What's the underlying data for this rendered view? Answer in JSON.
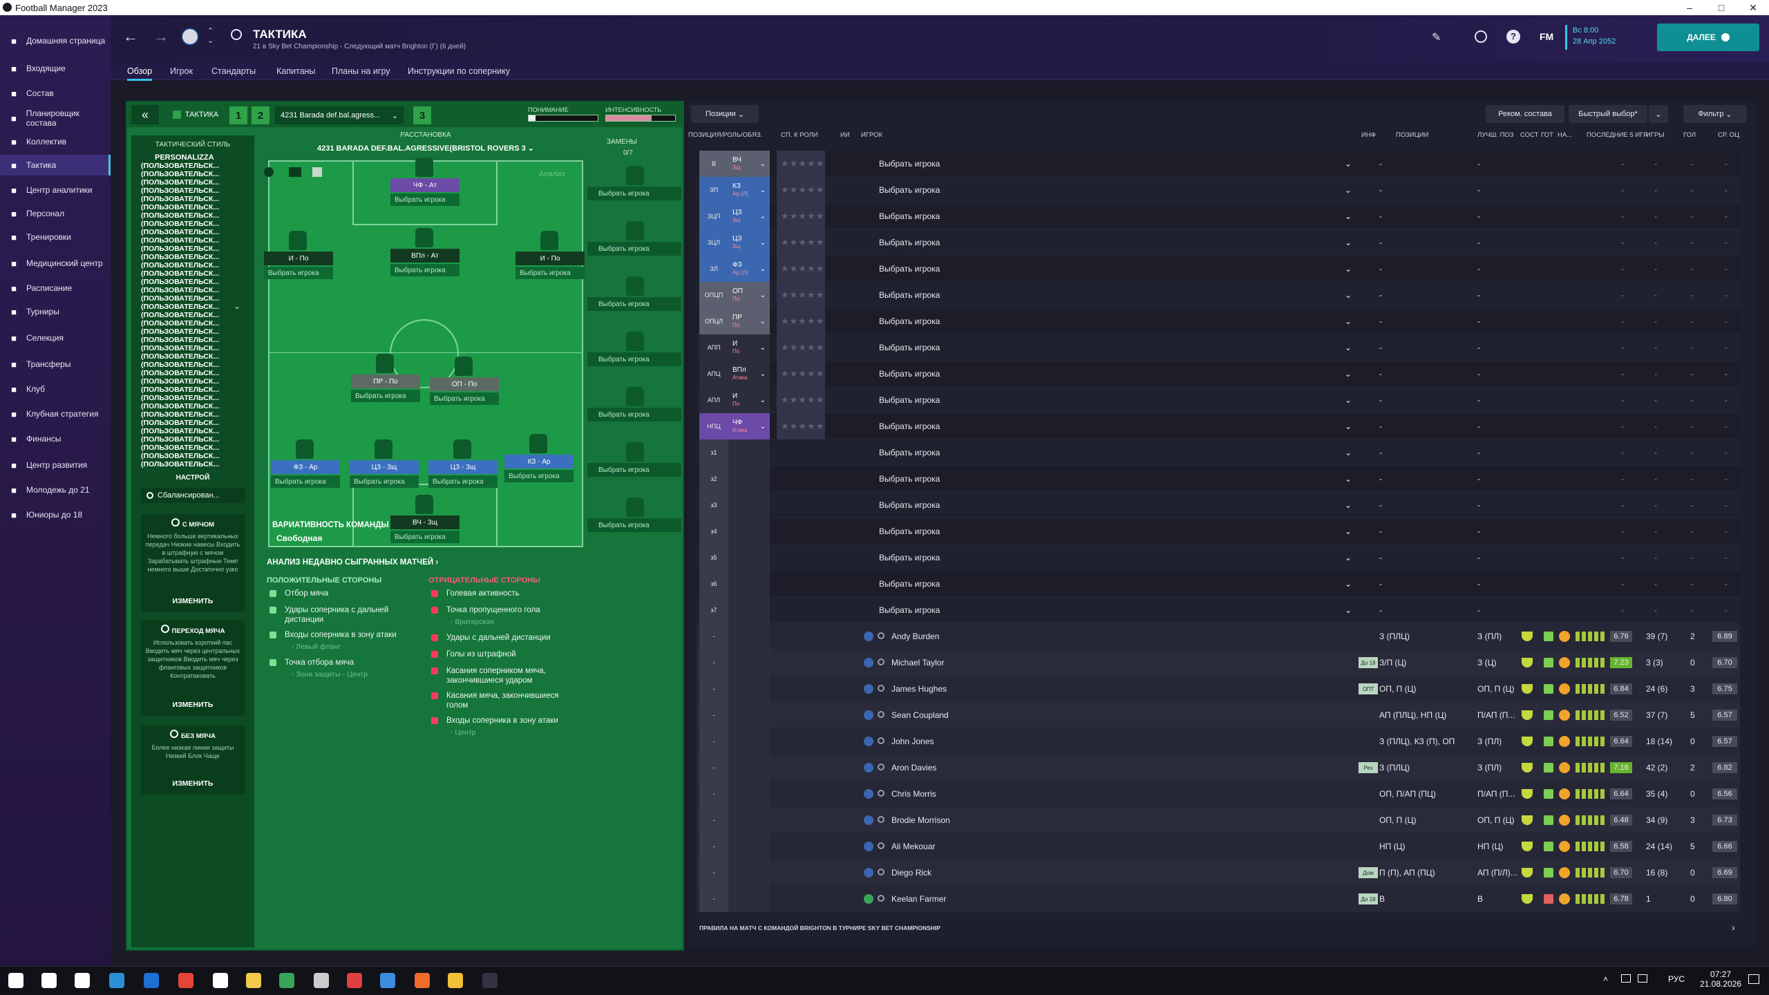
{
  "window": {
    "title": "Football Manager 2023"
  },
  "sidebar": {
    "items": [
      {
        "label": "Домашняя страница",
        "icon": "home-icon"
      },
      {
        "label": "Входящие",
        "icon": "inbox-icon"
      },
      {
        "label": "Состав",
        "icon": "squad-icon"
      },
      {
        "label": "Планировщик состава",
        "icon": "planner-icon"
      },
      {
        "label": "Коллектив",
        "icon": "dynamics-icon"
      },
      {
        "label": "Тактика",
        "icon": "tactics-icon"
      },
      {
        "label": "Центр аналитики",
        "icon": "analytics-icon"
      },
      {
        "label": "Персонал",
        "icon": "staff-icon"
      },
      {
        "label": "Тренировки",
        "icon": "training-icon"
      },
      {
        "label": "Медицинский центр",
        "icon": "medical-icon"
      },
      {
        "label": "Расписание",
        "icon": "schedule-icon"
      },
      {
        "label": "Турниры",
        "icon": "trophy-icon"
      },
      {
        "label": "Селекция",
        "icon": "scouting-icon"
      },
      {
        "label": "Трансферы",
        "icon": "transfers-icon"
      },
      {
        "label": "Клуб",
        "icon": "club-icon"
      },
      {
        "label": "Клубная стратегия",
        "icon": "strategy-icon"
      },
      {
        "label": "Финансы",
        "icon": "finance-icon"
      },
      {
        "label": "Центр развития",
        "icon": "development-icon"
      },
      {
        "label": "Молодежь до 21",
        "icon": "u21-icon"
      },
      {
        "label": "Юниоры до 18",
        "icon": "u18-icon"
      }
    ]
  },
  "header": {
    "title": "ТАКТИКА",
    "subtitle": "21 в Sky Bet Championship - Следующий матч Brighton (Г) (6 дней)",
    "date_time": "Вс 8:00",
    "date": "28 Апр 2052",
    "next_label": "ДАЛЕЕ",
    "fm_label": "FM"
  },
  "tabs": [
    "Обзор",
    "Игрок",
    "Стандарты",
    "Капитаны",
    "Планы на игру",
    "Инструкции по сопернику"
  ],
  "tactic": {
    "tag": "ТАКТИКА",
    "slots": [
      "1",
      "2",
      "3"
    ],
    "selected": "4231 Barada def.bal.agress...",
    "understanding_label": "ПОНИМАНИЕ",
    "intensity_label": "ИНТЕНСИВНОСТЬ",
    "style_title": "ТАКТИЧЕСКИЙ СТИЛЬ",
    "style_name": "PERSONALIZZA",
    "style_lines_text": "(ПОЛЬЗОВАТЕЛЬСК...",
    "style_lines_count": 37,
    "mentality_title": "НАСТРОЙ",
    "mentality": "Сбалансирован...",
    "in_possession": {
      "title": "С МЯЧОМ",
      "text": "Немного больше вертикальных передач Низкие навесы Входить в штрафную с мячом Зарабатывать штрафные Темп немного выше Достаточно узко",
      "action": "ИЗМЕНИТЬ"
    },
    "transition": {
      "title": "ПЕРЕХОД МЯЧА",
      "text": "Использовать короткий пас Вводить мяч через центральных защитников Вводить мяч через фланговых защитников Контратаковать",
      "action": "ИЗМЕНИТЬ"
    },
    "out_possession": {
      "title": "БЕЗ МЯЧА",
      "text": "Более низкая линия защиты Низкий Блок Чаще",
      "action": "ИЗМЕНИТЬ"
    },
    "formation_title": "РАССТАНОВКА",
    "formation_name": "4231 BARADA DEF.BAL.AGRESSIVE(BRISTOL ROVERS 3",
    "subs_label": "ЗАМЕНЫ",
    "subs_count": "0/7",
    "analysis_btn": "Анализ",
    "pick_label": "Выбрать игрока",
    "fluidity_title": "ВАРИАТИВНОСТЬ КОМАНДЫ",
    "fluidity_value": "Свободная"
  },
  "pitch_positions": [
    {
      "label": "ЧФ - Ат"
    },
    {
      "label": "И - По"
    },
    {
      "label": "ВПл - Ат"
    },
    {
      "label": "И - По"
    },
    {
      "label": "ПР - По"
    },
    {
      "label": "ОП - По"
    },
    {
      "label": "ФЗ - Ар"
    },
    {
      "label": "ЦЗ - Зщ"
    },
    {
      "label": "ЦЗ - Зщ"
    },
    {
      "label": "КЗ - Ар"
    },
    {
      "label": "ВЧ - Зщ"
    }
  ],
  "analysis": {
    "title": "АНАЛИЗ НЕДАВНО СЫГРАННЫХ МАТЧЕЙ",
    "positive_title": "ПОЛОЖИТЕЛЬНЫЕ СТОРОНЫ",
    "negative_title": "ОТРИЦАТЕЛЬНЫЕ СТОРОНЫ",
    "positive": [
      {
        "t": "Отбор мяча",
        "s": ""
      },
      {
        "t": "Удары соперника с дальней дистанции",
        "s": ""
      },
      {
        "t": "Входы соперника в зону атаки",
        "s": "- Левый фланг"
      },
      {
        "t": "Точка отбора мяча",
        "s": "- Зона защиты - Центр"
      }
    ],
    "negative": [
      {
        "t": "Голевая активность",
        "s": ""
      },
      {
        "t": "Точка пропущенного гола",
        "s": "- Вратарская"
      },
      {
        "t": "Удары с дальней дистанции",
        "s": ""
      },
      {
        "t": "Голы из штрафной",
        "s": ""
      },
      {
        "t": "Касания соперником мяча, закончившиеся ударом",
        "s": ""
      },
      {
        "t": "Касания мяча, закончившиеся голом",
        "s": ""
      },
      {
        "t": "Входы соперника в зону атаки",
        "s": "- Центр"
      }
    ]
  },
  "right": {
    "positions_btn": "Позиции",
    "recommend_btn": "Реком. состава",
    "quick_btn": "Быстрый выбор*",
    "filter_btn": "Фильтр",
    "columns": [
      "ПОЗИЦИЯ/РОЛЬ/ОБЯЗ.",
      "СП. К РОЛИ",
      "ИИ",
      "ИГРОК",
      "ИНФ",
      "ПОЗИЦИИ",
      "ЛУЧШ. ПОЗ",
      "СОСТ",
      "ГОТ",
      "НА...",
      "ПОСЛЕДНИЕ 5 ИГР",
      "ИГРЫ",
      "ГОЛ",
      "СР. ОЦ"
    ],
    "slots": [
      {
        "code": "В",
        "role": "ВЧ",
        "duty": "Зщ",
        "tone": "gray"
      },
      {
        "code": "ЗП",
        "role": "КЗ",
        "duty": "Ар (Л)",
        "tone": "blue"
      },
      {
        "code": "ЗЦП",
        "role": "ЦЗ",
        "duty": "Зщ",
        "tone": "blue"
      },
      {
        "code": "ЗЦЛ",
        "role": "ЦЗ",
        "duty": "Зщ",
        "tone": "blue"
      },
      {
        "code": "ЗЛ",
        "role": "ФЗ",
        "duty": "Ар (Л)",
        "tone": "blue"
      },
      {
        "code": "ОПЦП",
        "role": "ОП",
        "duty": "По",
        "tone": "gray"
      },
      {
        "code": "ОПЦЛ",
        "role": "ПР",
        "duty": "По",
        "tone": "gray"
      },
      {
        "code": "АПП",
        "role": "И",
        "duty": "По",
        "tone": "dark"
      },
      {
        "code": "АПЦ",
        "role": "ВПл",
        "duty": "Атака",
        "tone": "dark"
      },
      {
        "code": "АПЛ",
        "role": "И",
        "duty": "По",
        "tone": "dark"
      },
      {
        "code": "НПЦ",
        "role": "ЧФ",
        "duty": "Атака",
        "tone": "purple"
      },
      {
        "code": "з1",
        "role": "",
        "duty": "",
        "tone": "none"
      },
      {
        "code": "з2",
        "role": "",
        "duty": "",
        "tone": "none"
      },
      {
        "code": "з3",
        "role": "",
        "duty": "",
        "tone": "none"
      },
      {
        "code": "з4",
        "role": "",
        "duty": "",
        "tone": "none"
      },
      {
        "code": "з5",
        "role": "",
        "duty": "",
        "tone": "none"
      },
      {
        "code": "з6",
        "role": "",
        "duty": "",
        "tone": "none"
      },
      {
        "code": "з7",
        "role": "",
        "duty": "",
        "tone": "none"
      }
    ],
    "pick_text": "Выбрать игрока",
    "dash": "-",
    "players": [
      {
        "name": "Andy Burden",
        "info": "",
        "positions": "З (ПЛЦ)",
        "best": "З (ПЛ)",
        "form": "6.76",
        "games": "39 (7)",
        "goals": "2",
        "avg": "6.89"
      },
      {
        "name": "Michael Taylor",
        "info": "До 18",
        "positions": "З/П (Ц)",
        "best": "З (Ц)",
        "form": "7.23",
        "games": "3 (3)",
        "goals": "0",
        "avg": "6.70"
      },
      {
        "name": "James Hughes",
        "info": "ОПТ",
        "positions": "ОП, П (Ц)",
        "best": "ОП, П (Ц)",
        "form": "6.84",
        "games": "24 (6)",
        "goals": "3",
        "avg": "6.75"
      },
      {
        "name": "Sean Coupland",
        "info": "",
        "positions": "АП (ПЛЦ), НП (Ц)",
        "best": "П/АП (П...",
        "form": "6.52",
        "games": "37 (7)",
        "goals": "5",
        "avg": "6.57"
      },
      {
        "name": "John Jones",
        "info": "",
        "positions": "З (ПЛЦ), КЗ (П), ОП",
        "best": "З (ПЛ)",
        "form": "6.64",
        "games": "18 (14)",
        "goals": "0",
        "avg": "6.57"
      },
      {
        "name": "Aron Davies",
        "info": "Рез",
        "positions": "З (ПЛЦ)",
        "best": "З (ПЛ)",
        "form": "7.16",
        "games": "42 (2)",
        "goals": "2",
        "avg": "6.82"
      },
      {
        "name": "Chris Morris",
        "info": "",
        "positions": "ОП, П/АП (ПЦ)",
        "best": "П/АП (П...",
        "form": "6.64",
        "games": "35 (4)",
        "goals": "0",
        "avg": "6.56"
      },
      {
        "name": "Brodie Morrison",
        "info": "",
        "positions": "ОП, П (Ц)",
        "best": "ОП, П (Ц)",
        "form": "6.48",
        "games": "34 (9)",
        "goals": "3",
        "avg": "6.73"
      },
      {
        "name": "Ali Mekouar",
        "info": "",
        "positions": "НП (Ц)",
        "best": "НП (Ц)",
        "form": "6.58",
        "games": "24 (14)",
        "goals": "5",
        "avg": "6.66"
      },
      {
        "name": "Diego Rick",
        "info": "Дом",
        "positions": "П (П), АП (ПЦ)",
        "best": "АП (П/Л)...",
        "form": "6.70",
        "games": "16 (8)",
        "goals": "0",
        "avg": "6.69"
      },
      {
        "name": "Keelan Farmer",
        "info": "До 18",
        "positions": "В",
        "best": "В",
        "form": "6.78",
        "games": "1",
        "goals": "0",
        "avg": "6.80"
      }
    ],
    "footer": "ПРАВИЛА НА МАТЧ С КОМАНДОЙ BRIGHTON В ТУРНИРЕ SKY BET CHAMPIONSHIP"
  },
  "taskbar": {
    "time": "07:27",
    "date": "21.08.2026",
    "lang": "РУС"
  },
  "colors": {
    "accent": "#37c6e8",
    "pitch": "#1d9a48",
    "next": "#0f8f93"
  }
}
